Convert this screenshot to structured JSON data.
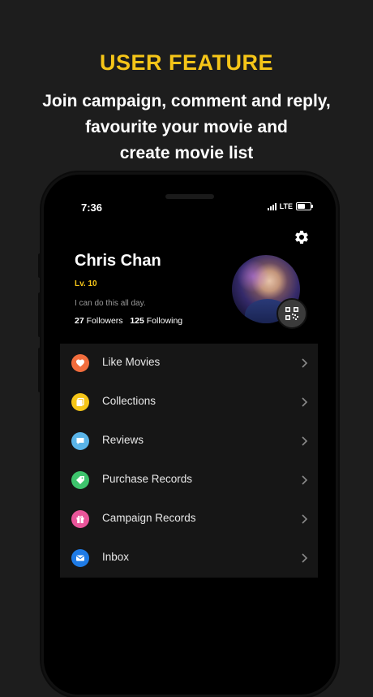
{
  "promo": {
    "headline": "USER FEATURE",
    "subline_1": "Join campaign, comment and reply,",
    "subline_2": "favourite your movie and",
    "subline_3": "create movie list"
  },
  "status_bar": {
    "time": "7:36",
    "network": "LTE",
    "battery_level": 0.7
  },
  "profile": {
    "name": "Chris Chan",
    "level": "Lv. 10",
    "bio": "I can do this all day.",
    "followers_count": "27",
    "followers_label": "Followers",
    "following_count": "125",
    "following_label": "Following"
  },
  "menu": {
    "items": [
      {
        "label": "Like Movies",
        "icon": "heart-icon",
        "color": "#f26d3d"
      },
      {
        "label": "Collections",
        "icon": "collection-icon",
        "color": "#f5c518"
      },
      {
        "label": "Reviews",
        "icon": "comment-icon",
        "color": "#5ab4e8"
      },
      {
        "label": "Purchase Records",
        "icon": "tag-icon",
        "color": "#3ec46d"
      },
      {
        "label": "Campaign Records",
        "icon": "gift-icon",
        "color": "#e9559a"
      },
      {
        "label": "Inbox",
        "icon": "mail-icon",
        "color": "#1e7be6"
      }
    ]
  },
  "colors": {
    "accent": "#f5c518",
    "background": "#1d1d1d",
    "menu_background": "#161616"
  }
}
